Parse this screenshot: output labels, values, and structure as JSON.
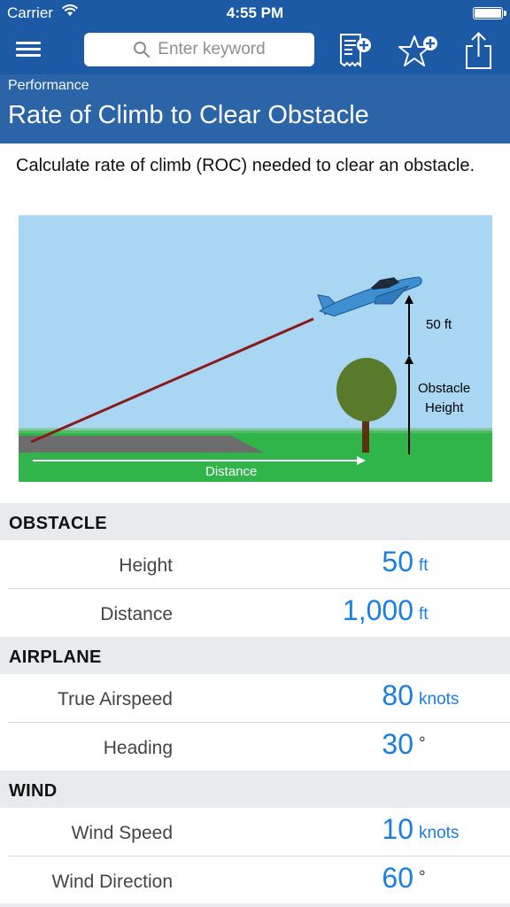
{
  "status_bar": {
    "carrier": "Carrier",
    "time": "4:55 PM"
  },
  "nav": {
    "search_placeholder": "Enter keyword",
    "icons": [
      "menu-icon",
      "search-icon",
      "add-calculation-icon",
      "add-favorite-icon",
      "share-icon"
    ]
  },
  "header": {
    "breadcrumb": "Performance",
    "title": "Rate of Climb to Clear Obstacle"
  },
  "description": "Calculate rate of climb (ROC) needed to clear an obstacle.",
  "diagram": {
    "label_50ft": "50 ft",
    "label_obstacle_1": "Obstacle",
    "label_obstacle_2": "Height",
    "label_distance": "Distance",
    "colors": {
      "sky": "#a9d6f2",
      "grass": "#2fb54a",
      "runway": "#6d6d6d",
      "path": "#8b1a1a",
      "plane": "#3d8fd1",
      "tree": "#5a7a2b"
    }
  },
  "sections": {
    "obstacle": {
      "title": "OBSTACLE",
      "rows": [
        {
          "label": "Height",
          "value": "50",
          "unit": "ft"
        },
        {
          "label": "Distance",
          "value": "1,000",
          "unit": "ft"
        }
      ]
    },
    "airplane": {
      "title": "AIRPLANE",
      "rows": [
        {
          "label": "True Airspeed",
          "value": "80",
          "unit": "knots"
        },
        {
          "label": "Heading",
          "value": "30",
          "unit": "°"
        }
      ]
    },
    "wind": {
      "title": "WIND",
      "rows": [
        {
          "label": "Wind Speed",
          "value": "10",
          "unit": "knots"
        },
        {
          "label": "Wind Direction",
          "value": "60",
          "unit": "°"
        }
      ]
    }
  },
  "accent_color": "#1a7fe0",
  "bar_color": "#1d5aa6"
}
